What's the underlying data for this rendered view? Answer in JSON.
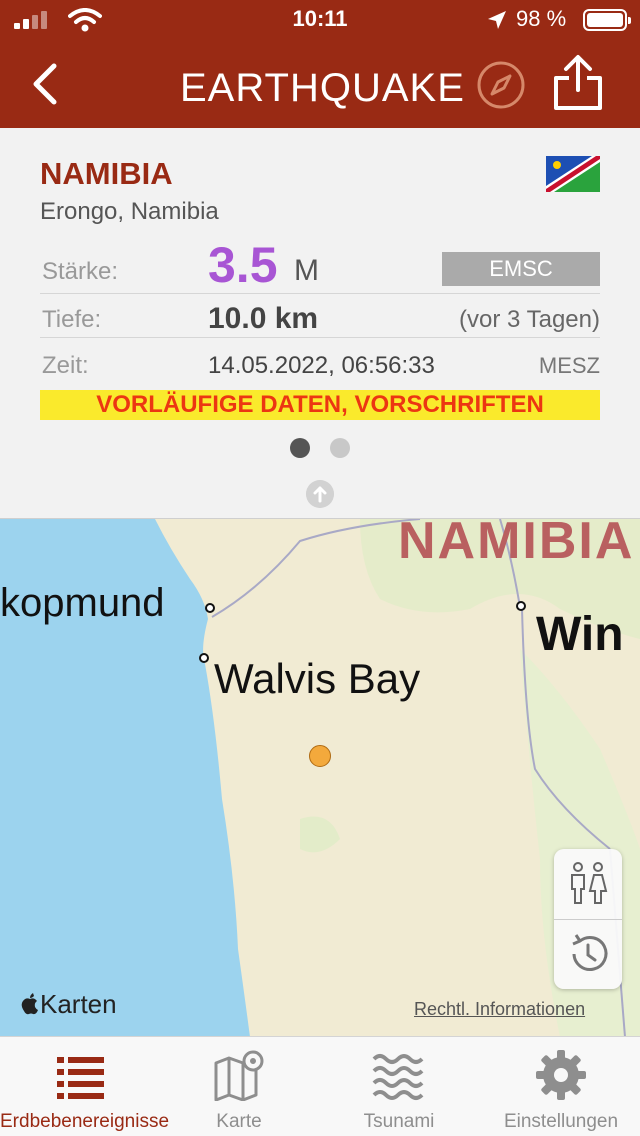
{
  "status_bar": {
    "time": "10:11",
    "battery": "98 %"
  },
  "nav": {
    "title": "EARTHQUAKE"
  },
  "event": {
    "region": "NAMIBIA",
    "location": "Erongo, Namibia",
    "magnitude_label": "Stärke:",
    "magnitude": "3.5",
    "magnitude_unit": "M",
    "source": "EMSC",
    "depth_label": "Tiefe:",
    "depth": "10.0 km",
    "ago": "(vor 3 Tagen)",
    "time_label": "Zeit:",
    "datetime": "14.05.2022, 06:56:33",
    "timezone": "MESZ",
    "warning": "VORLÄUFIGE DATEN, VORSCHRIFTEN"
  },
  "map": {
    "labels": {
      "country": "NAMIBIA",
      "city_swakopmund": "kopmund",
      "city_walvis": "Walvis Bay",
      "city_windhoek": "Win"
    },
    "attribution": "Karten",
    "legal": "Rechtl. Informationen"
  },
  "tabs": [
    {
      "label": "Erdbebenereignisse",
      "icon": "list-icon",
      "active": true
    },
    {
      "label": "Karte",
      "icon": "map-icon",
      "active": false
    },
    {
      "label": "Tsunami",
      "icon": "waves-icon",
      "active": false
    },
    {
      "label": "Einstellungen",
      "icon": "gear-icon",
      "active": false
    }
  ],
  "colors": {
    "brand": "#992a14",
    "magnitude": "#a855d4",
    "warning_bg": "#faea2c",
    "warning_text": "#ec3612",
    "quake_marker": "#f3a93c"
  }
}
